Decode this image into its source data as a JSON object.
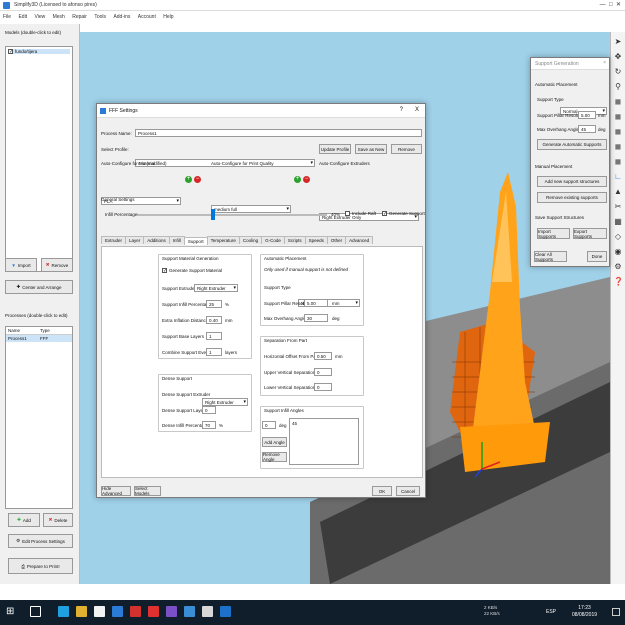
{
  "app": {
    "title": "Simplify3D (Licensed to afonso pires)"
  },
  "menu": [
    "File",
    "Edit",
    "View",
    "Mesh",
    "Repair",
    "Tools",
    "Add-ins",
    "Account",
    "Help"
  ],
  "models": {
    "header": "Models (double-click to edit)",
    "items": [
      "fundo/tijera"
    ],
    "import": "Import",
    "remove": "Remove",
    "center": "Center and Arrange"
  },
  "processes": {
    "header": "Processes (double-click to edit)",
    "col_name": "Name",
    "col_type": "Type",
    "row_name": "Process1",
    "row_type": "FFF",
    "add": "Add",
    "delete": "Delete",
    "edit": "Edit Process Settings",
    "prepare": "Prepare to Print!"
  },
  "fff": {
    "title": "FFF Settings",
    "help": "?",
    "close": "X",
    "process_name_label": "Process Name:",
    "process_name": "Process1",
    "select_profile_label": "Select Profile:",
    "profile": "mio (modified)",
    "update_profile": "Update Profile",
    "save_as_new": "Save as New",
    "remove": "Remove",
    "auto_material_label": "Auto-Configure for Material",
    "material": "PLA",
    "auto_quality_label": "Auto-Configure for Print Quality",
    "quality": "medium full",
    "auto_extruders_label": "Auto-Configure Extruders",
    "extruders": "Right Extruder Only",
    "general_label": "General Settings",
    "infill_label": "Infill Percentage:",
    "infill_value": "40%",
    "infill_fraction": 0.4,
    "include_raft": "Include Raft",
    "generate_support": "Generate Support",
    "tabs": [
      "Extruder",
      "Layer",
      "Additions",
      "Infill",
      "Support",
      "Temperature",
      "Cooling",
      "G-Code",
      "Scripts",
      "Speeds",
      "Other",
      "Advanced"
    ],
    "active_tab": "Support",
    "smg": {
      "title": "Support Material Generation",
      "generate_material": "Generate Support Material",
      "extruder_label": "Support Extruder",
      "extruder": "Right Extruder",
      "infill_pct_label": "Support Infill Percentage",
      "infill_pct": "25",
      "pct_unit": "%",
      "inflation_label": "Extra Inflation Distance",
      "inflation": "0.40",
      "mm": "mm",
      "base_layers_label": "Support Base Layers",
      "base_layers": "1",
      "combine_label": "Combine Support Every",
      "combine": "1",
      "layers_unit": "layers"
    },
    "dense": {
      "title": "Dense Support",
      "extruder_label": "Dense Support Extruder",
      "extruder": "Right Extruder",
      "layers_label": "Dense Support Layers",
      "layers": "0",
      "infill_label": "Dense Infill Percentage",
      "infill": "70",
      "pct_unit": "%"
    },
    "auto": {
      "title": "Automatic Placement",
      "note": "Only used if manual support is not defined",
      "type_label": "Support Type",
      "type": "Normal",
      "pillar_label": "Support Pillar Resolution",
      "pillar": "5.00",
      "mm": "mm",
      "overhang_label": "Max Overhang Angle",
      "overhang": "30",
      "deg": "deg"
    },
    "sep": {
      "title": "Separation From Part",
      "horiz_label": "Horizontal Offset From Part",
      "horiz": "0.50",
      "mm": "mm",
      "upper_label": "Upper Vertical Separation Layers",
      "upper": "0",
      "lower_label": "Lower Vertical Separation Layers",
      "lower": "0"
    },
    "angles": {
      "title": "Support Infill Angles",
      "angle": "0",
      "deg": "deg",
      "list_value": "45",
      "add": "Add Angle",
      "remove": "Remove Angle"
    },
    "hide_advanced": "Hide Advanced",
    "select_models": "Select Models",
    "ok": "OK",
    "cancel": "Cancel"
  },
  "supgen": {
    "title": "Support Generation",
    "close": "×",
    "auto_label": "Automatic Placement",
    "type_label": "Support Type",
    "type": "Normal",
    "pillar_label": "Support Pillar Resolution",
    "pillar": "5.00",
    "mm": "mm",
    "overhang_label": "Max Overhang Angle",
    "overhang": "45",
    "deg": "deg",
    "generate": "Generate Automatic Supports",
    "manual_label": "Manual Placement",
    "add_new": "Add new support structures",
    "remove_existing": "Remove existing supports",
    "save_label": "Save Support Structures",
    "import": "Import Supports",
    "export": "Export Supports",
    "clear_all": "Clear All Supports",
    "done": "Done"
  },
  "taskbar": {
    "lang": "ESP",
    "time": "17:23",
    "date": "08/08/2019",
    "net1": "2 KB/s",
    "net2": "22 KB/s"
  },
  "colors": {
    "accent": "#0078d7",
    "viewport": "#9fd1e9",
    "orange": "#ffa31a",
    "taskbar": "#101d2b"
  }
}
